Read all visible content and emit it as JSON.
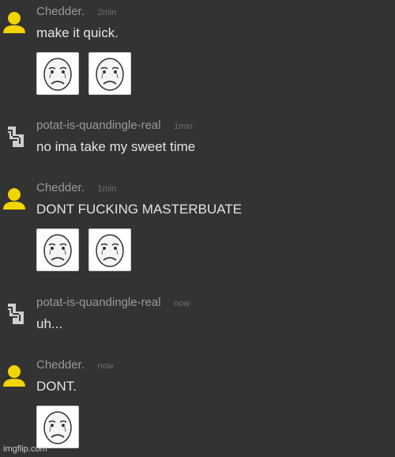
{
  "messages": [
    {
      "username": "Chedder.",
      "time": "2min",
      "text": "make it quick.",
      "avatar": "yellow-user-icon",
      "emotes": [
        "crying-face-emote",
        "crying-face-emote"
      ]
    },
    {
      "username": "potat-is-quandingle-real",
      "time": "1min",
      "text": "no ima take my sweet time",
      "avatar": "pixel-logo-icon",
      "emotes": []
    },
    {
      "username": "Chedder.",
      "time": "1min",
      "text": "DONT FUCKING MASTERBUATE",
      "avatar": "yellow-user-icon",
      "emotes": [
        "crying-face-emote",
        "crying-face-emote"
      ]
    },
    {
      "username": "potat-is-quandingle-real",
      "time": "now",
      "text": "uh...",
      "avatar": "pixel-logo-icon",
      "emotes": []
    },
    {
      "username": "Chedder.",
      "time": "now",
      "text": "DONT.",
      "avatar": "yellow-user-icon",
      "emotes": [
        "crying-face-emote"
      ]
    }
  ],
  "watermark": "imgflip.com",
  "colors": {
    "background": "#333333",
    "username": "#9a9a9a",
    "timestamp": "#6d6d6d",
    "text": "#e4e4e4",
    "avatar_yellow": "#f2d400"
  }
}
